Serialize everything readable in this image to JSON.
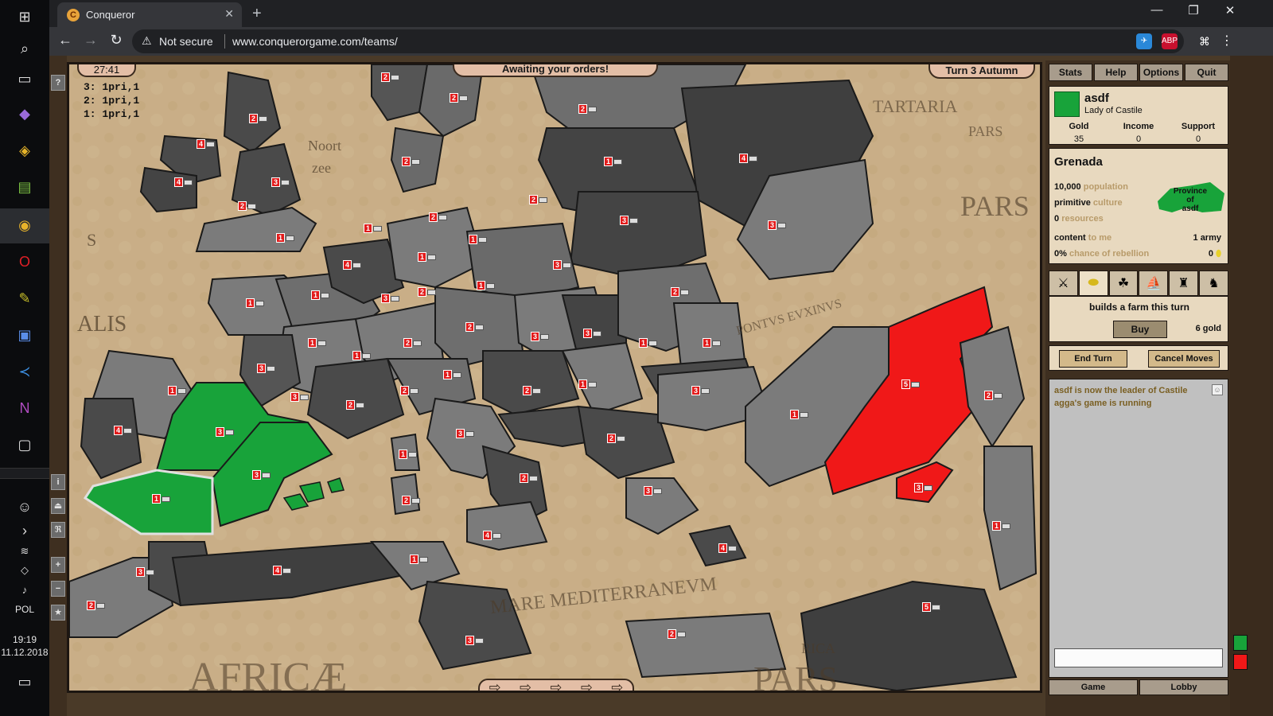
{
  "taskbar": {
    "lang": "POL",
    "time": "19:19",
    "date": "11.12.2018"
  },
  "browser": {
    "tab_title": "Conqueror",
    "favicon_letter": "C",
    "security_label": "Not secure",
    "url": "www.conquerorgame.com/teams/",
    "ext_abp_label": "ABP"
  },
  "game": {
    "timer": "27:41",
    "status_banner": "Awaiting your orders!",
    "turn_label": "Turn 3  Autumn",
    "order_queue": [
      "3: 1pri,1",
      "2: 1pri,1",
      "1: 1pri,1"
    ],
    "side_tools": [
      "?",
      "i",
      "⏏",
      "ℜ",
      "+",
      "−",
      "★"
    ],
    "map_labels": [
      "Noort",
      "zee",
      "S",
      "ALIS",
      "TARTARIA",
      "PARS",
      "PARS",
      "PONTVS EVXINVS",
      "MARE MEDITERRANEVM",
      "AFRICÆ",
      "PARS",
      "RICA"
    ]
  },
  "panel": {
    "menu": [
      "Stats",
      "Help",
      "Options",
      "Quit"
    ],
    "player": {
      "name": "asdf",
      "title": "Lady of Castile",
      "color": "#18a33a",
      "gold_label": "Gold",
      "gold": "35",
      "income_label": "Income",
      "income": "0",
      "support_label": "Support",
      "support": "0"
    },
    "province": {
      "name": "Grenada",
      "population_value": "10,000",
      "population_label": "population",
      "culture_value": "primitive",
      "culture_label": "culture",
      "resources_value": "0",
      "resources_label": "resources",
      "mood_value": "content",
      "mood_label": "to me",
      "rebellion_value": "0%",
      "rebellion_label": "chance of rebellion",
      "army_count": "1 army",
      "gold_count": "0",
      "owner_label_1": "Province",
      "owner_label_2": "of",
      "owner_label_3": "asdf"
    },
    "action": {
      "description": "builds a farm this turn",
      "buy_label": "Buy",
      "cost": "6 gold"
    },
    "turn_buttons": {
      "end_turn": "End Turn",
      "cancel_moves": "Cancel Moves"
    },
    "chat": {
      "messages": [
        "asdf is now the leader of Castile",
        "agga's game is running"
      ]
    },
    "bottom_tabs": [
      "Game",
      "Lobby"
    ]
  },
  "colors": {
    "player_green": "#18a33a",
    "enemy_red": "#f01818",
    "land_dark": "#4a4a4a",
    "land_light": "#7b7b7b",
    "parchment": "#c9ae87"
  }
}
